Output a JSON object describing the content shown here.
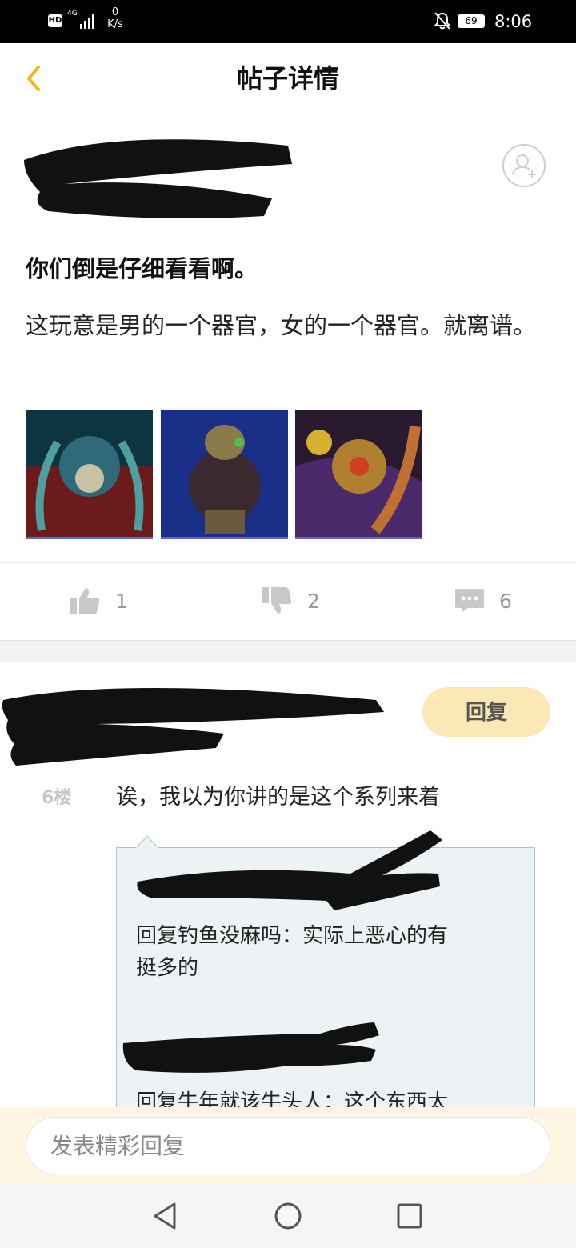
{
  "status_bar": {
    "hd": "HD",
    "network": "4G",
    "speed_value": "0",
    "speed_unit": "K/s",
    "battery": "69",
    "time": "8:06"
  },
  "header": {
    "title": "帖子详情"
  },
  "post": {
    "title": "你们倒是仔细看看啊。",
    "body": "这玩意是男的一个器官，女的一个器官。就离谱。",
    "images": [
      {
        "name": "card-art-1",
        "colors": [
          "#0d3540",
          "#6b1b1b",
          "#2e6a7a"
        ]
      },
      {
        "name": "card-art-2",
        "colors": [
          "#1a2f88",
          "#3a2a30",
          "#6a5a3a"
        ]
      },
      {
        "name": "card-art-3",
        "colors": [
          "#4a2a6a",
          "#b08030",
          "#2a1a30"
        ]
      }
    ],
    "likes": "1",
    "dislikes": "2",
    "comments": "6"
  },
  "comment": {
    "reply_label": "回复",
    "floor": "6楼",
    "text": "诶，我以为你讲的是这个系列来着",
    "sub_replies": [
      {
        "text_line1": "回复钓鱼没麻吗：实际上恶心的有",
        "text_line2": "挺多的"
      },
      {
        "text_line1": "回复牛年就该牛头人：这个东西太"
      }
    ]
  },
  "input": {
    "placeholder": "发表精彩回复"
  },
  "colors": {
    "accent": "#f1b520",
    "reply_bg": "#fbe8b4",
    "sub_bg": "#edf2f5",
    "sub_border": "#a9c4d1"
  }
}
